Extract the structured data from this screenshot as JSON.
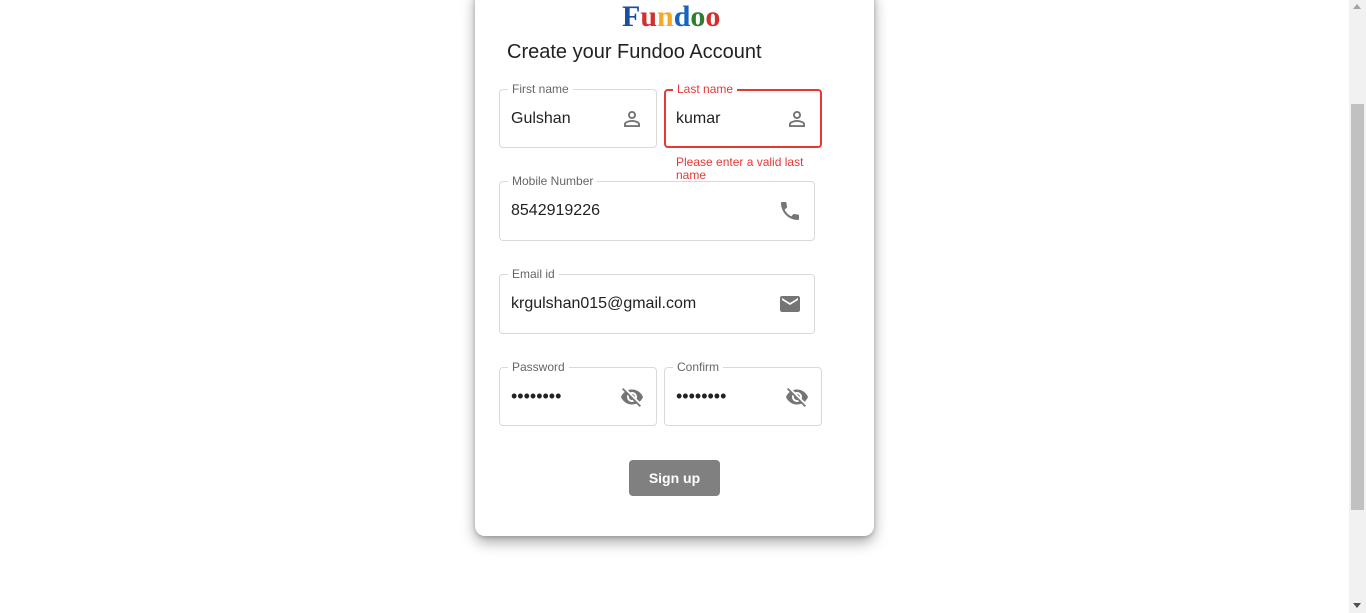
{
  "logo": {
    "letters": [
      "F",
      "u",
      "n",
      "d",
      "o",
      "o"
    ],
    "colors": [
      "#1a4f9c",
      "#d32f2f",
      "#f9a825",
      "#1565c0",
      "#2e7d32",
      "#d32f2f"
    ]
  },
  "title": "Create your Fundoo Account",
  "fields": {
    "first_name": {
      "label": "First name",
      "value": "Gulshan",
      "icon": "person-icon"
    },
    "last_name": {
      "label": "Last name",
      "value": "kumar",
      "icon": "person-icon",
      "error": "Please enter a valid last name"
    },
    "mobile": {
      "label": "Mobile Number",
      "value": "8542919226",
      "icon": "phone-icon"
    },
    "email": {
      "label": "Email id",
      "value": "krgulshan015@gmail.com",
      "icon": "mail-icon"
    },
    "password": {
      "label": "Password",
      "value": "••••••••",
      "icon": "eye-off-icon"
    },
    "confirm": {
      "label": "Confirm",
      "value": "••••••••",
      "icon": "eye-off-icon"
    }
  },
  "signup_label": "Sign up",
  "colors": {
    "error": "#e53935",
    "button": "#808080",
    "icon": "#757575"
  }
}
